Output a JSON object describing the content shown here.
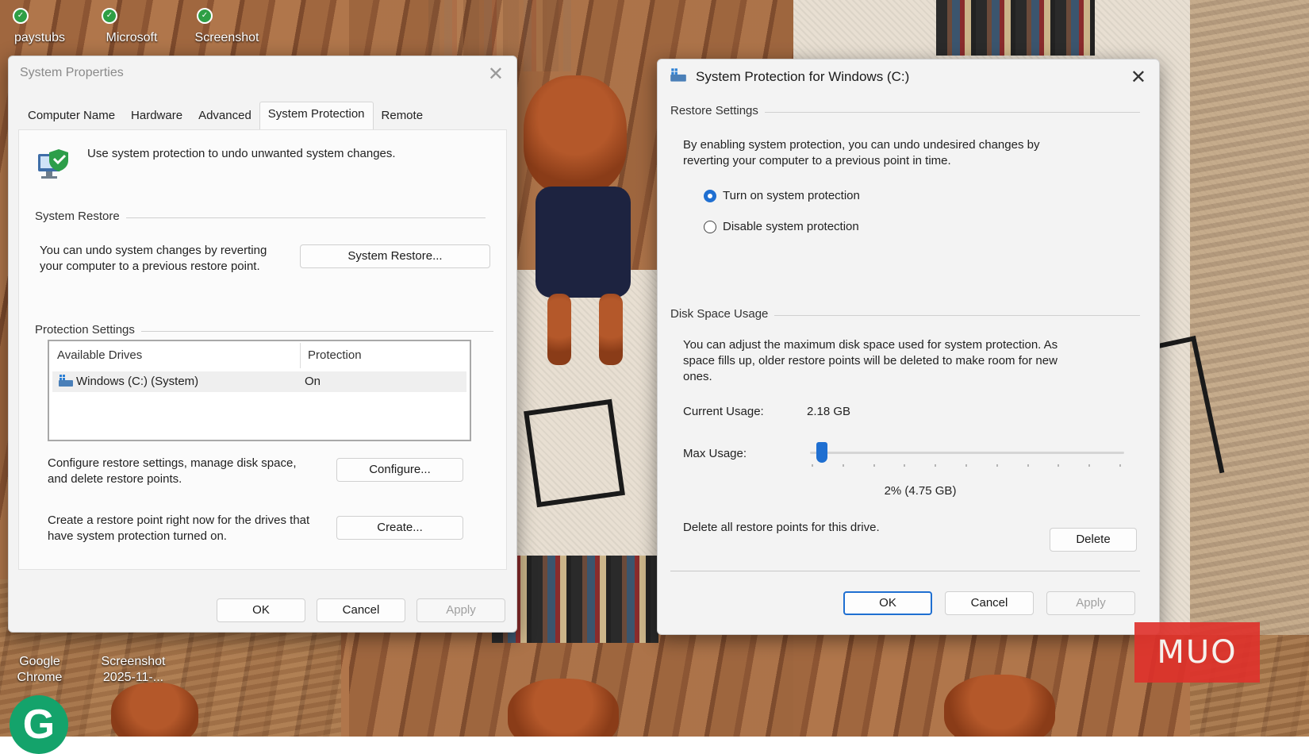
{
  "desktop": {
    "icons_top": [
      {
        "label": "paystubs"
      },
      {
        "label": "Microsoft"
      },
      {
        "label": "Screenshot"
      }
    ],
    "icons_bottom": [
      {
        "label": "Google\nChrome"
      },
      {
        "label": "Screenshot\n2025-11-..."
      }
    ],
    "watermark": "MUO"
  },
  "system_properties": {
    "title": "System Properties",
    "tabs": [
      {
        "label": "Computer Name"
      },
      {
        "label": "Hardware"
      },
      {
        "label": "Advanced"
      },
      {
        "label": "System Protection",
        "active": true
      },
      {
        "label": "Remote"
      }
    ],
    "intro": "Use system protection to undo unwanted system changes.",
    "system_restore": {
      "group": "System Restore",
      "description": "You can undo system changes by reverting\nyour computer to a previous restore point.",
      "button": "System Restore..."
    },
    "protection_settings": {
      "group": "Protection Settings",
      "columns": [
        "Available Drives",
        "Protection"
      ],
      "rows": [
        {
          "drive": "Windows (C:) (System)",
          "protection": "On"
        }
      ]
    },
    "configure": {
      "description": "Configure restore settings, manage disk space,\nand delete restore points.",
      "button": "Configure..."
    },
    "create": {
      "description": "Create a restore point right now for the drives that\nhave system protection turned on.",
      "button": "Create..."
    },
    "footer": {
      "ok": "OK",
      "cancel": "Cancel",
      "apply": "Apply"
    }
  },
  "protection_dialog": {
    "title": "System Protection for Windows (C:)",
    "restore_settings": {
      "group": "Restore Settings",
      "description": "By enabling system protection, you can undo undesired changes by\nreverting your computer to a previous point in time.",
      "options": [
        {
          "label": "Turn on system protection",
          "checked": true
        },
        {
          "label": "Disable system protection",
          "checked": false
        }
      ]
    },
    "disk_space": {
      "group": "Disk Space Usage",
      "description": "You can adjust the maximum disk space used for system protection. As\nspace fills up, older restore points will be deleted to make room for new\nones.",
      "current_usage_label": "Current Usage:",
      "current_usage_value": "2.18 GB",
      "max_usage_label": "Max Usage:",
      "max_usage_percent": 2,
      "max_usage_value": "2% (4.75 GB)",
      "delete_text": "Delete all restore points for this drive.",
      "delete_button": "Delete"
    },
    "footer": {
      "ok": "OK",
      "cancel": "Cancel",
      "apply": "Apply"
    }
  },
  "colors": {
    "accent": "#1f6fd1",
    "watermark": "#e0312b"
  }
}
